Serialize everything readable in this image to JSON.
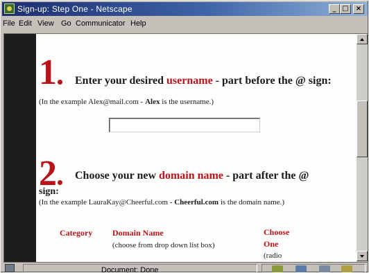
{
  "window": {
    "title": "Sign-up: Step One - Netscape",
    "buttons": {
      "minimize": "_",
      "maximize": "□",
      "close": "×"
    }
  },
  "menu": [
    "File",
    "Edit",
    "View",
    "Go",
    "Communicator",
    "Help"
  ],
  "page": {
    "step1": {
      "number": "1",
      "heading_prefix": "Enter your desired ",
      "heading_keyword": "username",
      "heading_suffix": " - part before the @ sign:",
      "note_prefix": "(In the example Alex@mail.com - ",
      "note_bold": "Alex",
      "note_suffix": " is the username.)",
      "input_value": ""
    },
    "step2": {
      "number": "2",
      "heading_prefix": "Choose your new ",
      "heading_keyword": "domain name",
      "heading_suffix": " - part after the @",
      "heading_wrap": "sign:",
      "note_prefix": "(In the example LauraKay@Cheerful.com - ",
      "note_bold": "Cheerful.com",
      "note_suffix": " is the domain name.)"
    },
    "table": {
      "col_category": "Category",
      "col_domain": "Domain Name",
      "col_domain_hint": "(choose from drop down list box)",
      "col_choose_line1": "Choose",
      "col_choose_line2": "One",
      "col_choose_hint": "(radio"
    }
  },
  "status": {
    "text": "Document: Done"
  },
  "colors": {
    "accent": "#b8121a",
    "title_start": "#1c2d6e",
    "title_end": "#8fb0d8",
    "chrome": "#c4c1bb"
  },
  "icons": [
    "netscape-app-icon",
    "security-lock-icon",
    "navigator-icon",
    "mail-icon",
    "discussions-icon",
    "composer-icon"
  ]
}
